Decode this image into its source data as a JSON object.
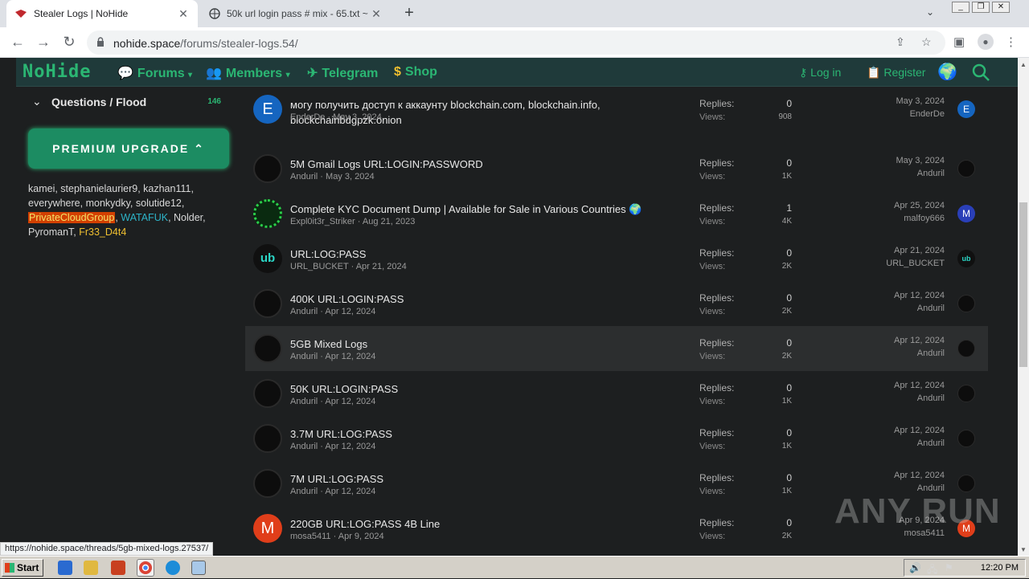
{
  "browser": {
    "tabs": [
      {
        "title": "Stealer Logs | NoHide",
        "active": true
      },
      {
        "title": "50k url login pass # mix - 65.txt ~ pi",
        "active": false
      }
    ],
    "url_host": "nohide.space",
    "url_path": "/forums/stealer-logs.54/"
  },
  "site": {
    "logo": "NoHide",
    "nav": [
      {
        "label": "Forums",
        "icon": "chat-icon"
      },
      {
        "label": "Members",
        "icon": "users-icon"
      },
      {
        "label": "Telegram",
        "icon": "telegram-icon"
      },
      {
        "label": "Shop",
        "icon": "coin-icon"
      }
    ],
    "login": "Log in",
    "register": "Register"
  },
  "sidebar": {
    "flood_label": "Questions / Flood",
    "flood_count": "146",
    "premium": "PREMIUM UPGRADE",
    "online_users": [
      {
        "name": "kamei",
        "style": "normal"
      },
      {
        "name": "stephanielaurier9",
        "style": "normal"
      },
      {
        "name": "kazhan111",
        "style": "normal"
      },
      {
        "name": "everywhere",
        "style": "normal"
      },
      {
        "name": "monkydky",
        "style": "normal"
      },
      {
        "name": "solutide12",
        "style": "normal"
      },
      {
        "name": "PrivateCloudGroup",
        "style": "gold"
      },
      {
        "name": "WATAFUK",
        "style": "teal"
      },
      {
        "name": "Nolder",
        "style": "normal"
      },
      {
        "name": "PyromanT",
        "style": "normal"
      },
      {
        "name": "Fr33_D4t4",
        "style": "yellow"
      }
    ]
  },
  "labels": {
    "replies": "Replies:",
    "views": "Views:"
  },
  "threads": [
    {
      "title": "могу получить доступ к аккаунту blockchain.com, blockchain.info, blockchainbdgpzk.onion",
      "author": "EnderDe",
      "date": "May 3, 2024",
      "replies": "0",
      "views": "908",
      "last_date": "May 3, 2024",
      "last_user": "EnderDe",
      "avatar": "E",
      "avatar_style": "e",
      "last_avatar": "E",
      "last_avatar_style": "e"
    },
    {
      "title": "5M Gmail Logs URL:LOGIN:PASSWORD",
      "author": "Anduril",
      "date": "May 3, 2024",
      "replies": "0",
      "views": "1K",
      "last_date": "May 3, 2024",
      "last_user": "Anduril",
      "avatar": "",
      "avatar_style": "dark",
      "last_avatar": "",
      "last_avatar_style": "dark"
    },
    {
      "title": "Complete KYC Document Dump | Available for Sale in Various Countries 🌍",
      "author": "Expl0it3r_Striker",
      "date": "Aug 21, 2023",
      "replies": "1",
      "views": "4K",
      "last_date": "Apr 25, 2024",
      "last_user": "malfoy666",
      "avatar": "",
      "avatar_style": "green",
      "last_avatar": "M",
      "last_avatar_style": "mblue"
    },
    {
      "title": "URL:LOG:PASS",
      "author": "URL_BUCKET",
      "date": "Apr 21, 2024",
      "replies": "0",
      "views": "2K",
      "last_date": "Apr 21, 2024",
      "last_user": "URL_BUCKET",
      "avatar": "ub",
      "avatar_style": "ub",
      "last_avatar": "ub",
      "last_avatar_style": "ub"
    },
    {
      "title": "400K URL:LOGIN:PASS",
      "author": "Anduril",
      "date": "Apr 12, 2024",
      "replies": "0",
      "views": "2K",
      "last_date": "Apr 12, 2024",
      "last_user": "Anduril",
      "avatar": "",
      "avatar_style": "dark",
      "last_avatar": "",
      "last_avatar_style": "dark"
    },
    {
      "title": "5GB Mixed Logs",
      "author": "Anduril",
      "date": "Apr 12, 2024",
      "replies": "0",
      "views": "2K",
      "last_date": "Apr 12, 2024",
      "last_user": "Anduril",
      "avatar": "",
      "avatar_style": "dark",
      "last_avatar": "",
      "last_avatar_style": "dark",
      "highlight": true
    },
    {
      "title": "50K URL:LOGIN:PASS",
      "author": "Anduril",
      "date": "Apr 12, 2024",
      "replies": "0",
      "views": "1K",
      "last_date": "Apr 12, 2024",
      "last_user": "Anduril",
      "avatar": "",
      "avatar_style": "dark",
      "last_avatar": "",
      "last_avatar_style": "dark"
    },
    {
      "title": "3.7M URL:LOG:PASS",
      "author": "Anduril",
      "date": "Apr 12, 2024",
      "replies": "0",
      "views": "1K",
      "last_date": "Apr 12, 2024",
      "last_user": "Anduril",
      "avatar": "",
      "avatar_style": "dark",
      "last_avatar": "",
      "last_avatar_style": "dark"
    },
    {
      "title": "7M URL:LOG:PASS",
      "author": "Anduril",
      "date": "Apr 12, 2024",
      "replies": "0",
      "views": "1K",
      "last_date": "Apr 12, 2024",
      "last_user": "Anduril",
      "avatar": "",
      "avatar_style": "dark",
      "last_avatar": "",
      "last_avatar_style": "dark"
    },
    {
      "title": "220GB URL:LOG:PASS 4B Line",
      "author": "mosa5411",
      "date": "Apr 9, 2024",
      "replies": "0",
      "views": "2K",
      "last_date": "Apr 9, 2024",
      "last_user": "mosa5411",
      "avatar": "M",
      "avatar_style": "m",
      "last_avatar": "M",
      "last_avatar_style": "m"
    }
  ],
  "status_url": "https://nohide.space/threads/5gb-mixed-logs.27537/",
  "watermark": "ANY RUN",
  "taskbar": {
    "start": "Start",
    "clock": "12:20 PM"
  }
}
